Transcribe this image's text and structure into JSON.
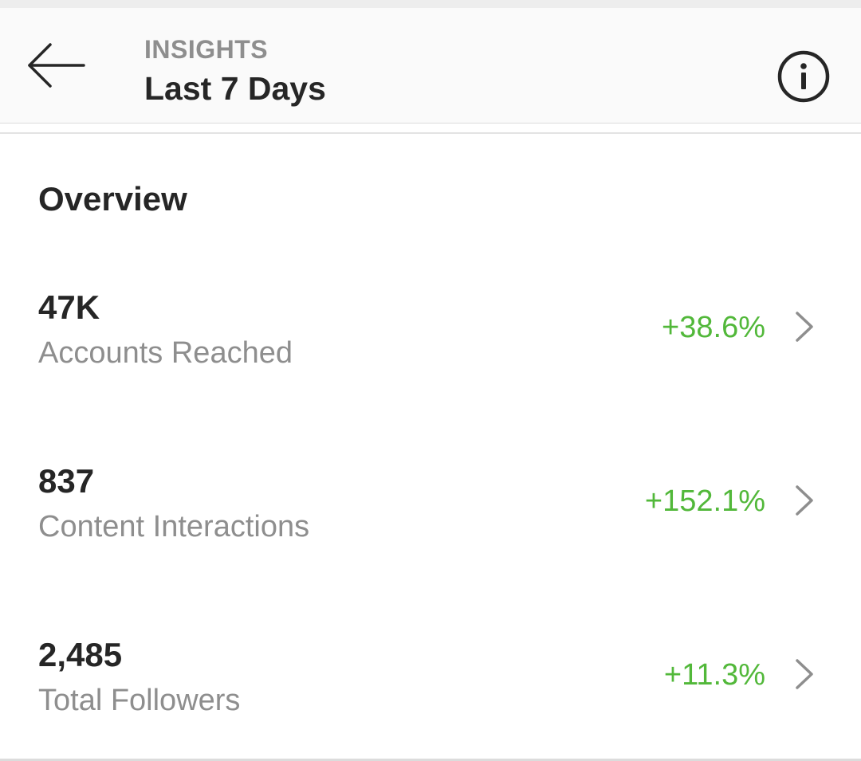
{
  "header": {
    "eyebrow": "INSIGHTS",
    "title": "Last 7 Days",
    "back_icon": "arrow-left-icon",
    "info_icon": "info-circle-icon"
  },
  "overview": {
    "title": "Overview",
    "metrics": [
      {
        "value": "47K",
        "label": "Accounts Reached",
        "change": "+38.6%"
      },
      {
        "value": "837",
        "label": "Content Interactions",
        "change": "+152.1%"
      },
      {
        "value": "2,485",
        "label": "Total Followers",
        "change": "+11.3%"
      }
    ]
  },
  "colors": {
    "positive_change": "#52b83a",
    "secondary_text": "#8e8e8e",
    "primary_text": "#262626",
    "header_bg": "#fafafa"
  }
}
